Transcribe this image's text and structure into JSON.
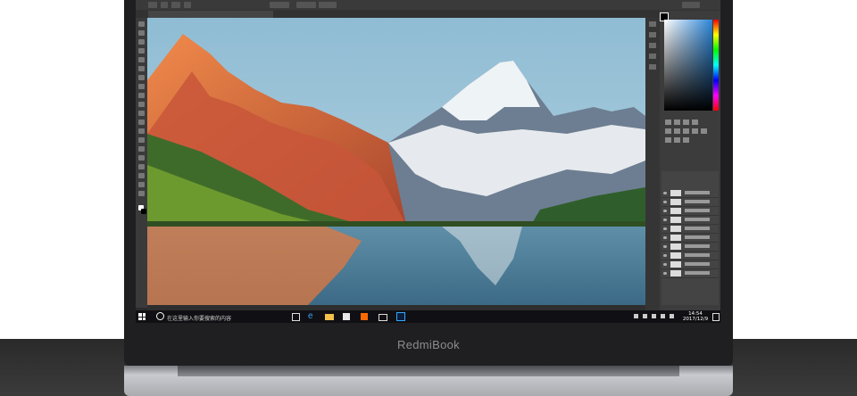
{
  "brand": {
    "logo_text": "RedmiBook"
  },
  "photoshop": {
    "document_tab": "      ",
    "zoom": " "
  },
  "taskbar": {
    "search_placeholder": "在这里输入你要搜索的内容",
    "time": "14:54",
    "date": "2017/12/9"
  },
  "colors": {
    "bezel": "#1f1f21",
    "panel": "#3c3c3c",
    "taskbar": "#101014",
    "sky": "#9fc4d8",
    "alpenglow": "#e8673a"
  },
  "icons": [
    "windows-start-icon",
    "cortana-icon",
    "task-view-icon",
    "edge-icon",
    "file-explorer-icon",
    "store-icon",
    "mi-icon",
    "mail-icon",
    "photoshop-icon",
    "network-icon",
    "volume-icon",
    "notification-icon"
  ]
}
